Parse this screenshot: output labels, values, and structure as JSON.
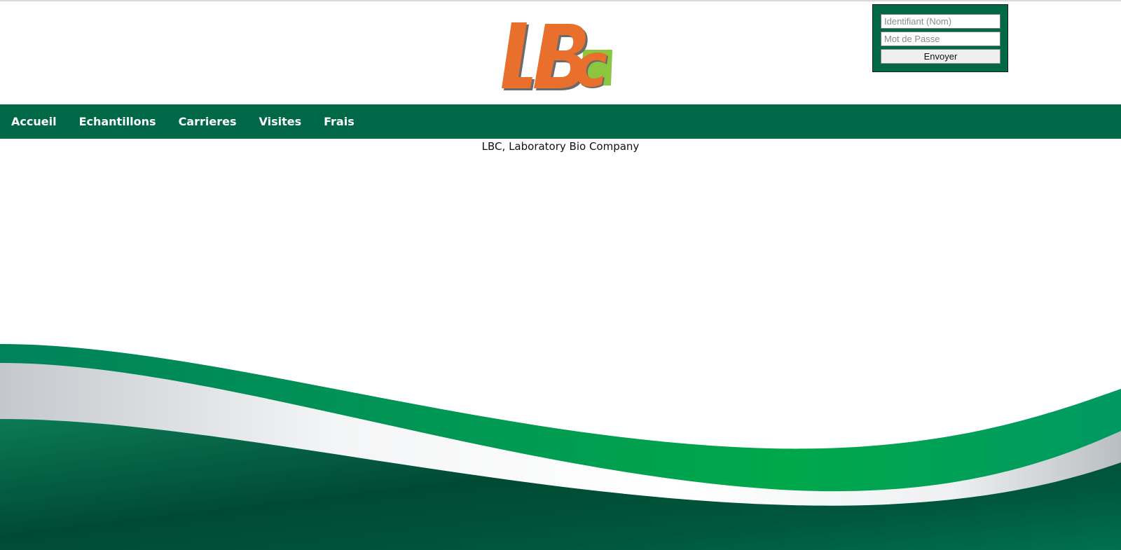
{
  "logo": {
    "text": "LBc",
    "colors": {
      "orange": "#e8702c",
      "green": "#8cc63f",
      "dark": "#555555"
    }
  },
  "login": {
    "username_placeholder": "Identifiant (Nom)",
    "username_value": "",
    "password_placeholder": "Mot de Passe",
    "password_value": "",
    "submit_label": "Envoyer"
  },
  "nav": {
    "items": [
      {
        "label": "Accueil"
      },
      {
        "label": "Echantillons"
      },
      {
        "label": "Carrieres"
      },
      {
        "label": "Visites"
      },
      {
        "label": "Frais"
      }
    ]
  },
  "main": {
    "tagline": "LBC, Laboratory Bio Company"
  },
  "theme": {
    "primary_green": "#006847",
    "bright_green": "#00a04a",
    "white": "#ffffff"
  }
}
